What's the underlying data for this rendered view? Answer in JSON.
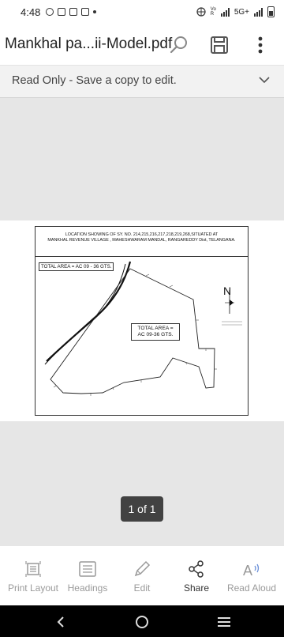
{
  "status_bar": {
    "time": "4:48",
    "network": "5G+"
  },
  "toolbar": {
    "title": "Mankhal  pa...ii-Model.pdf"
  },
  "banner": {
    "text": "Read Only - Save a copy to edit."
  },
  "document": {
    "header_line1": "LOCATION SHOWING OF SY. NO. 214,215,216,217,218,219,268,SITUATED AT",
    "header_line2": "MANKHAL REVENUE VILLAGE , MAHESHWARAM MANDAL, RANGAREDDY Dist, TELANGANA.",
    "total_area_top": "TOTAL AREA = AC 09 - 36 GTS.",
    "total_area_box_line1": "TOTAL AREA =",
    "total_area_box_line2": "AC 09-36 GTS.",
    "north_label": "N"
  },
  "page_indicator": "1 of 1",
  "bottom_bar": {
    "items": [
      {
        "label": "Print Layout",
        "icon": "print-layout-icon"
      },
      {
        "label": "Headings",
        "icon": "headings-icon"
      },
      {
        "label": "Edit",
        "icon": "pen-icon"
      },
      {
        "label": "Share",
        "icon": "share-icon"
      },
      {
        "label": "Read Aloud",
        "icon": "read-aloud-icon"
      }
    ]
  }
}
